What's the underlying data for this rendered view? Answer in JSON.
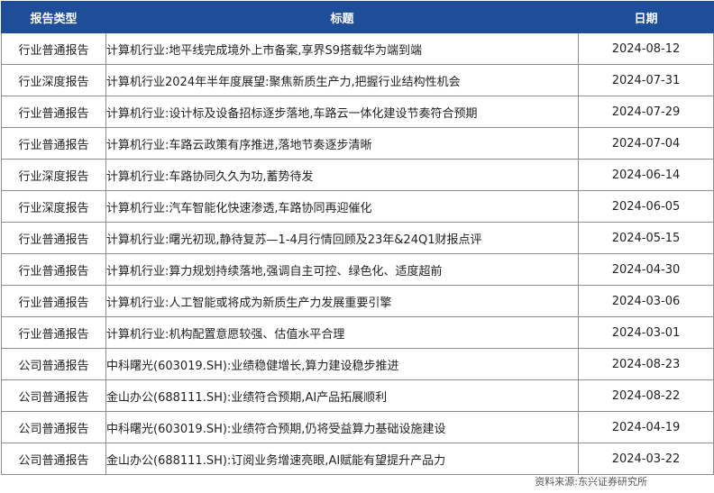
{
  "table": {
    "headers": [
      "报告类型",
      "标题",
      "日期"
    ],
    "rows": [
      {
        "type": "行业普通报告",
        "title": "计算机行业:地平线完成境外上市备案,享界S9搭载华为端到端",
        "date": "2024-08-12"
      },
      {
        "type": "行业深度报告",
        "title": "计算机行业2024年半年度展望:聚焦新质生产力,把握行业结构性机会",
        "date": "2024-07-31"
      },
      {
        "type": "行业普通报告",
        "title": "计算机行业:设计标及设备招标逐步落地,车路云一体化建设节奏符合预期",
        "date": "2024-07-29"
      },
      {
        "type": "行业普通报告",
        "title": "计算机行业:车路云政策有序推进,落地节奏逐步清晰",
        "date": "2024-07-04"
      },
      {
        "type": "行业深度报告",
        "title": "计算机行业:车路协同久久为功,蓄势待发",
        "date": "2024-06-14"
      },
      {
        "type": "行业深度报告",
        "title": "计算机行业:汽车智能化快速渗透,车路协同再迎催化",
        "date": "2024-06-05"
      },
      {
        "type": "行业普通报告",
        "title": "计算机行业:曙光初现,静待复苏—1-4月行情回顾及23年&24Q1财报点评",
        "date": "2024-05-15"
      },
      {
        "type": "行业普通报告",
        "title": "计算机行业:算力规划持续落地,强调自主可控、绿色化、适度超前",
        "date": "2024-04-30"
      },
      {
        "type": "行业普通报告",
        "title": "计算机行业:人工智能或将成为新质生产力发展重要引擎",
        "date": "2024-03-06"
      },
      {
        "type": "行业普通报告",
        "title": "计算机行业:机构配置意愿较强、估值水平合理",
        "date": "2024-03-01"
      },
      {
        "type": "公司普通报告",
        "title": "中科曙光(603019.SH):业绩稳健增长,算力建设稳步推进",
        "date": "2024-08-23"
      },
      {
        "type": "公司普通报告",
        "title": "金山办公(688111.SH):业绩符合预期,AI产品拓展顺利",
        "date": "2024-08-22"
      },
      {
        "type": "公司普通报告",
        "title": "中科曙光(603019.SH):业绩符合预期,仍将受益算力基础设施建设",
        "date": "2024-04-19"
      },
      {
        "type": "公司普通报告",
        "title": "金山办公(688111.SH):订阅业务增速亮眼,AI赋能有望提升产品力",
        "date": "2024-03-22"
      }
    ]
  },
  "source": "资料来源:东兴证券研究所",
  "colors": {
    "header_bg": "#1f4e99",
    "header_text": "#ffffff",
    "border": "#8c8c8c"
  }
}
